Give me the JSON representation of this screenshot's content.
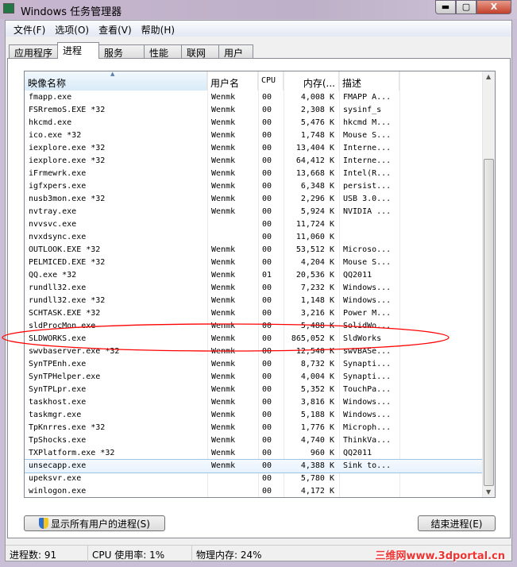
{
  "window": {
    "title": "Windows 任务管理器",
    "min": "▬",
    "max": "▢",
    "close": "X"
  },
  "menu": [
    "文件(F)",
    "选项(O)",
    "查看(V)",
    "帮助(H)"
  ],
  "tabs": [
    "应用程序",
    "进程",
    "服务",
    "性能",
    "联网",
    "用户"
  ],
  "columns": [
    "映像名称",
    "用户名",
    "CPU",
    "内存(...",
    "描述"
  ],
  "rows": [
    [
      "fmapp.exe",
      "Wenmk",
      "00",
      "4,008 K",
      "FMAPP A..."
    ],
    [
      "FSRremoS.EXE *32",
      "Wenmk",
      "00",
      "2,308 K",
      "sysinf_s"
    ],
    [
      "hkcmd.exe",
      "Wenmk",
      "00",
      "5,476 K",
      "hkcmd M..."
    ],
    [
      "ico.exe *32",
      "Wenmk",
      "00",
      "1,748 K",
      "Mouse S..."
    ],
    [
      "iexplore.exe *32",
      "Wenmk",
      "00",
      "13,404 K",
      "Interne..."
    ],
    [
      "iexplore.exe *32",
      "Wenmk",
      "00",
      "64,412 K",
      "Interne..."
    ],
    [
      "iFrmewrk.exe",
      "Wenmk",
      "00",
      "13,668 K",
      "Intel(R..."
    ],
    [
      "igfxpers.exe",
      "Wenmk",
      "00",
      "6,348 K",
      "persist..."
    ],
    [
      "nusb3mon.exe *32",
      "Wenmk",
      "00",
      "2,296 K",
      "USB 3.0..."
    ],
    [
      "nvtray.exe",
      "Wenmk",
      "00",
      "5,924 K",
      "NVIDIA ..."
    ],
    [
      "nvvsvc.exe",
      "",
      "00",
      "11,724 K",
      ""
    ],
    [
      "nvxdsync.exe",
      "",
      "00",
      "11,060 K",
      ""
    ],
    [
      "OUTLOOK.EXE *32",
      "Wenmk",
      "00",
      "53,512 K",
      "Microso..."
    ],
    [
      "PELMICED.EXE *32",
      "Wenmk",
      "00",
      "4,204 K",
      "Mouse S..."
    ],
    [
      "QQ.exe *32",
      "Wenmk",
      "01",
      "20,536 K",
      "QQ2011"
    ],
    [
      "rundll32.exe",
      "Wenmk",
      "00",
      "7,232 K",
      "Windows..."
    ],
    [
      "rundll32.exe *32",
      "Wenmk",
      "00",
      "1,148 K",
      "Windows..."
    ],
    [
      "SCHTASK.EXE *32",
      "Wenmk",
      "00",
      "3,216 K",
      "Power M..."
    ],
    [
      "sldProcMon.exe",
      "Wenmk",
      "00",
      "5,488 K",
      "SolidWo..."
    ],
    [
      "SLDWORKS.exe",
      "Wenmk",
      "00",
      "865,052 K",
      "SldWorks"
    ],
    [
      "swvbaserver.exe *32",
      "Wenmk",
      "00",
      "12,540 K",
      "swVBASe..."
    ],
    [
      "SynTPEnh.exe",
      "Wenmk",
      "00",
      "8,732 K",
      "Synapti..."
    ],
    [
      "SynTPHelper.exe",
      "Wenmk",
      "00",
      "4,004 K",
      "Synapti..."
    ],
    [
      "SynTPLpr.exe",
      "Wenmk",
      "00",
      "5,352 K",
      "TouchPa..."
    ],
    [
      "taskhost.exe",
      "Wenmk",
      "00",
      "3,816 K",
      "Windows..."
    ],
    [
      "taskmgr.exe",
      "Wenmk",
      "00",
      "5,188 K",
      "Windows..."
    ],
    [
      "TpKnrres.exe *32",
      "Wenmk",
      "00",
      "1,776 K",
      "Microph..."
    ],
    [
      "TpShocks.exe",
      "Wenmk",
      "00",
      "4,740 K",
      "ThinkVa..."
    ],
    [
      "TXPlatform.exe *32",
      "Wenmk",
      "00",
      "960 K",
      "QQ2011"
    ],
    [
      "unsecapp.exe",
      "Wenmk",
      "00",
      "4,388 K",
      "Sink to..."
    ],
    [
      "upeksvr.exe",
      "",
      "00",
      "5,780 K",
      ""
    ],
    [
      "winlogon.exe",
      "",
      "00",
      "4,172 K",
      ""
    ]
  ],
  "selected_row": 29,
  "buttons": {
    "show_all": "显示所有用户的进程(S)",
    "end_process": "结束进程(E)"
  },
  "status": {
    "processes": "进程数: 91",
    "cpu": "CPU 使用率: 1%",
    "memory": "物理内存: 24%"
  },
  "watermark": "三维网www.3dportal.cn",
  "annotation_color": "#ff0000"
}
